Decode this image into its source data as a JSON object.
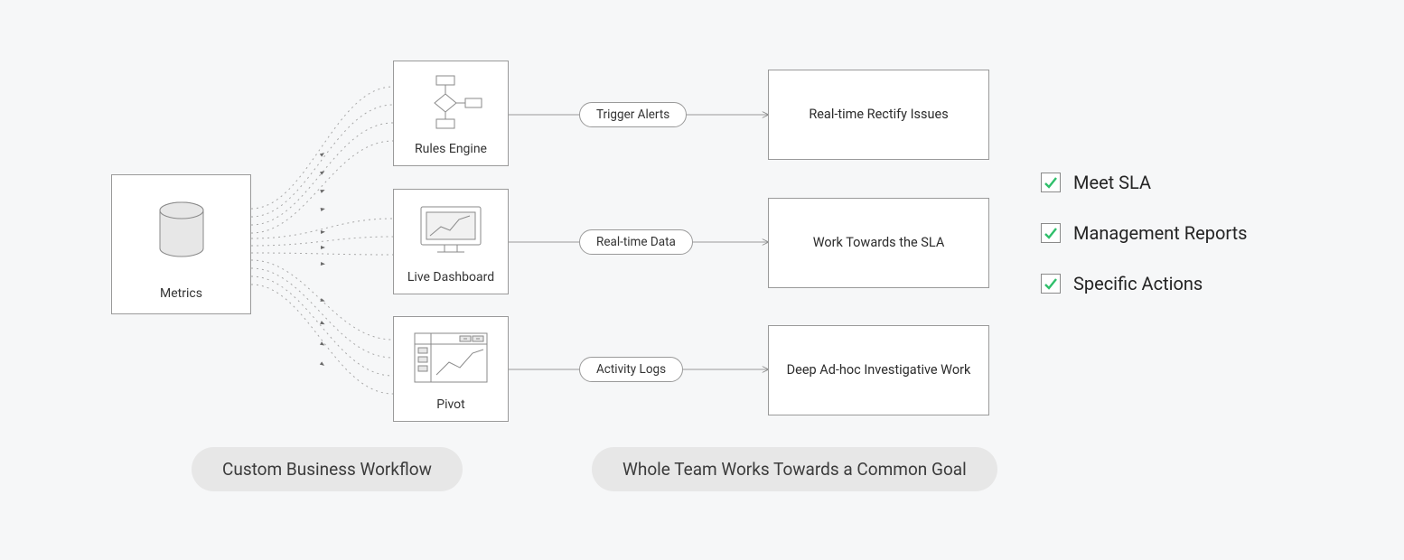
{
  "metrics": {
    "label": "Metrics",
    "icon": "database-icon"
  },
  "engines": [
    {
      "label": "Rules Engine",
      "icon": "flowchart-icon"
    },
    {
      "label": "Live Dashboard",
      "icon": "monitor-chart-icon"
    },
    {
      "label": "Pivot",
      "icon": "pivot-analysis-icon"
    }
  ],
  "pills": [
    {
      "label": "Trigger Alerts"
    },
    {
      "label": "Real-time Data"
    },
    {
      "label": "Activity Logs"
    }
  ],
  "results": [
    {
      "label": "Real-time Rectify Issues"
    },
    {
      "label": "Work Towards the SLA"
    },
    {
      "label": "Deep Ad-hoc Investigative Work"
    }
  ],
  "sections": {
    "left": "Custom Business Workflow",
    "right": "Whole Team Works Towards a Common Goal"
  },
  "checklist": [
    {
      "label": "Meet SLA",
      "checked": true
    },
    {
      "label": "Management Reports",
      "checked": true
    },
    {
      "label": "Specific Actions",
      "checked": true
    }
  ],
  "colors": {
    "checkmark": "#2fbf6b",
    "line": "#8a8a8a",
    "lineLight": "#b5b5b5"
  }
}
